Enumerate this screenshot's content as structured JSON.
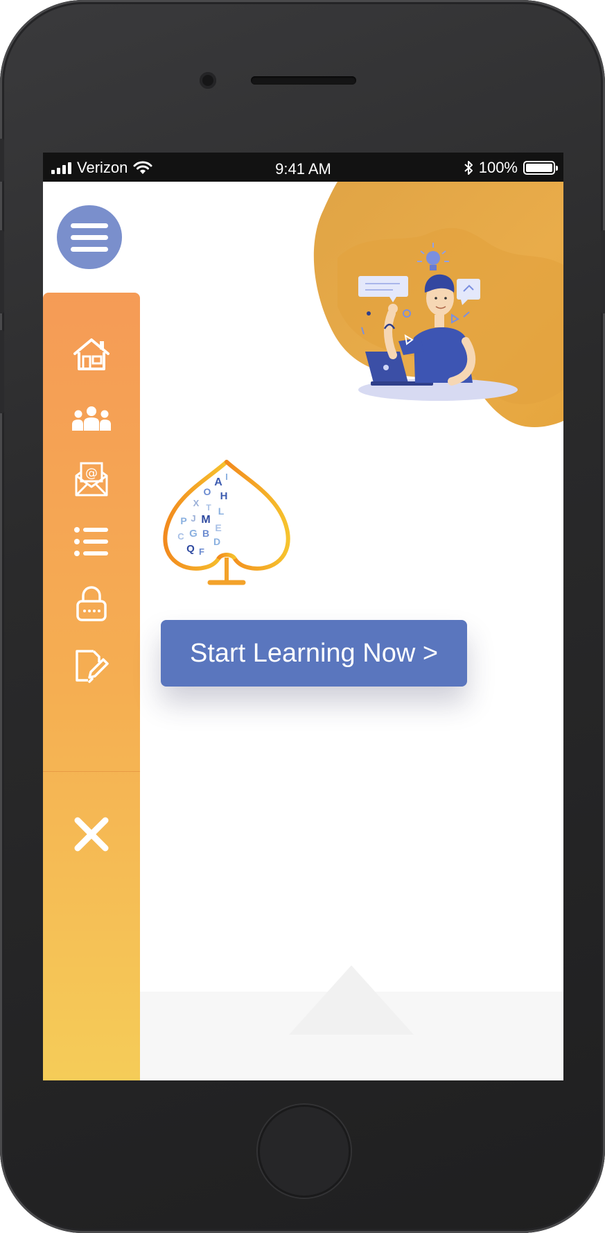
{
  "status_bar": {
    "carrier": "Verizon",
    "time": "9:41 AM",
    "battery": "100%"
  },
  "menu": {
    "icon": "hamburger-icon"
  },
  "sidebar": {
    "items": [
      {
        "icon": "home-icon"
      },
      {
        "icon": "group-icon"
      },
      {
        "icon": "mail-icon"
      },
      {
        "icon": "list-icon"
      },
      {
        "icon": "lock-icon"
      },
      {
        "icon": "edit-icon"
      }
    ],
    "close_icon": "close-icon"
  },
  "logo": {
    "letters": [
      "A",
      "I",
      "O",
      "H",
      "X",
      "T",
      "L",
      "P",
      "J",
      "M",
      "E",
      "C",
      "G",
      "B",
      "D",
      "Q",
      "F"
    ]
  },
  "cta": {
    "label": "Start Learning Now >"
  },
  "colors": {
    "accent": "#5a76be",
    "menu_button": "#7a8fcc",
    "sidebar_top": "#f59b56",
    "sidebar_bottom": "#f5cc58",
    "hero_blob": "#e9a640"
  }
}
